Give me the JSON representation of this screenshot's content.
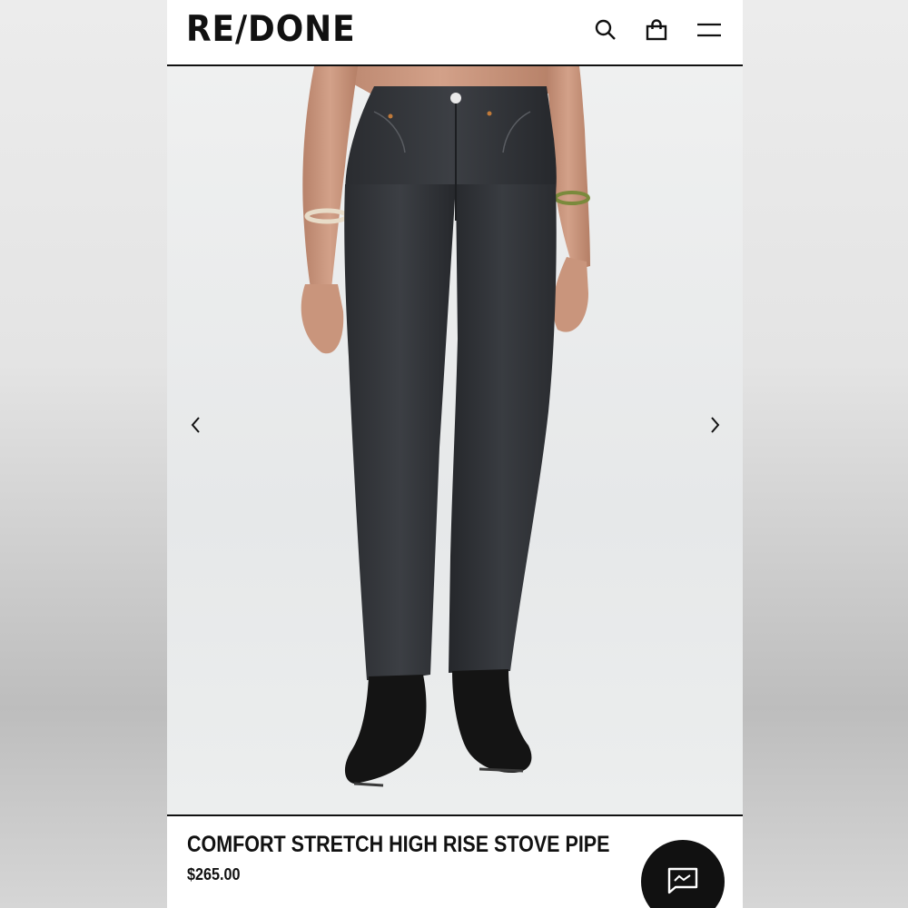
{
  "header": {
    "logo": "RE/DONE",
    "icons": [
      "search-icon",
      "shopping-bag-icon",
      "menu-icon"
    ]
  },
  "gallery": {
    "prev_icon": "chevron-left-icon",
    "next_icon": "chevron-right-icon",
    "image": "model wearing black high rise straight jeans with black cowboy boots"
  },
  "product": {
    "title": "COMFORT STRETCH HIGH RISE STOVE PIPE",
    "price": "$265.00"
  },
  "chat": {
    "icon": "chat-icon"
  },
  "colors": {
    "brand": "#111111",
    "background": "#ffffff",
    "denim": "#2c2e32"
  }
}
